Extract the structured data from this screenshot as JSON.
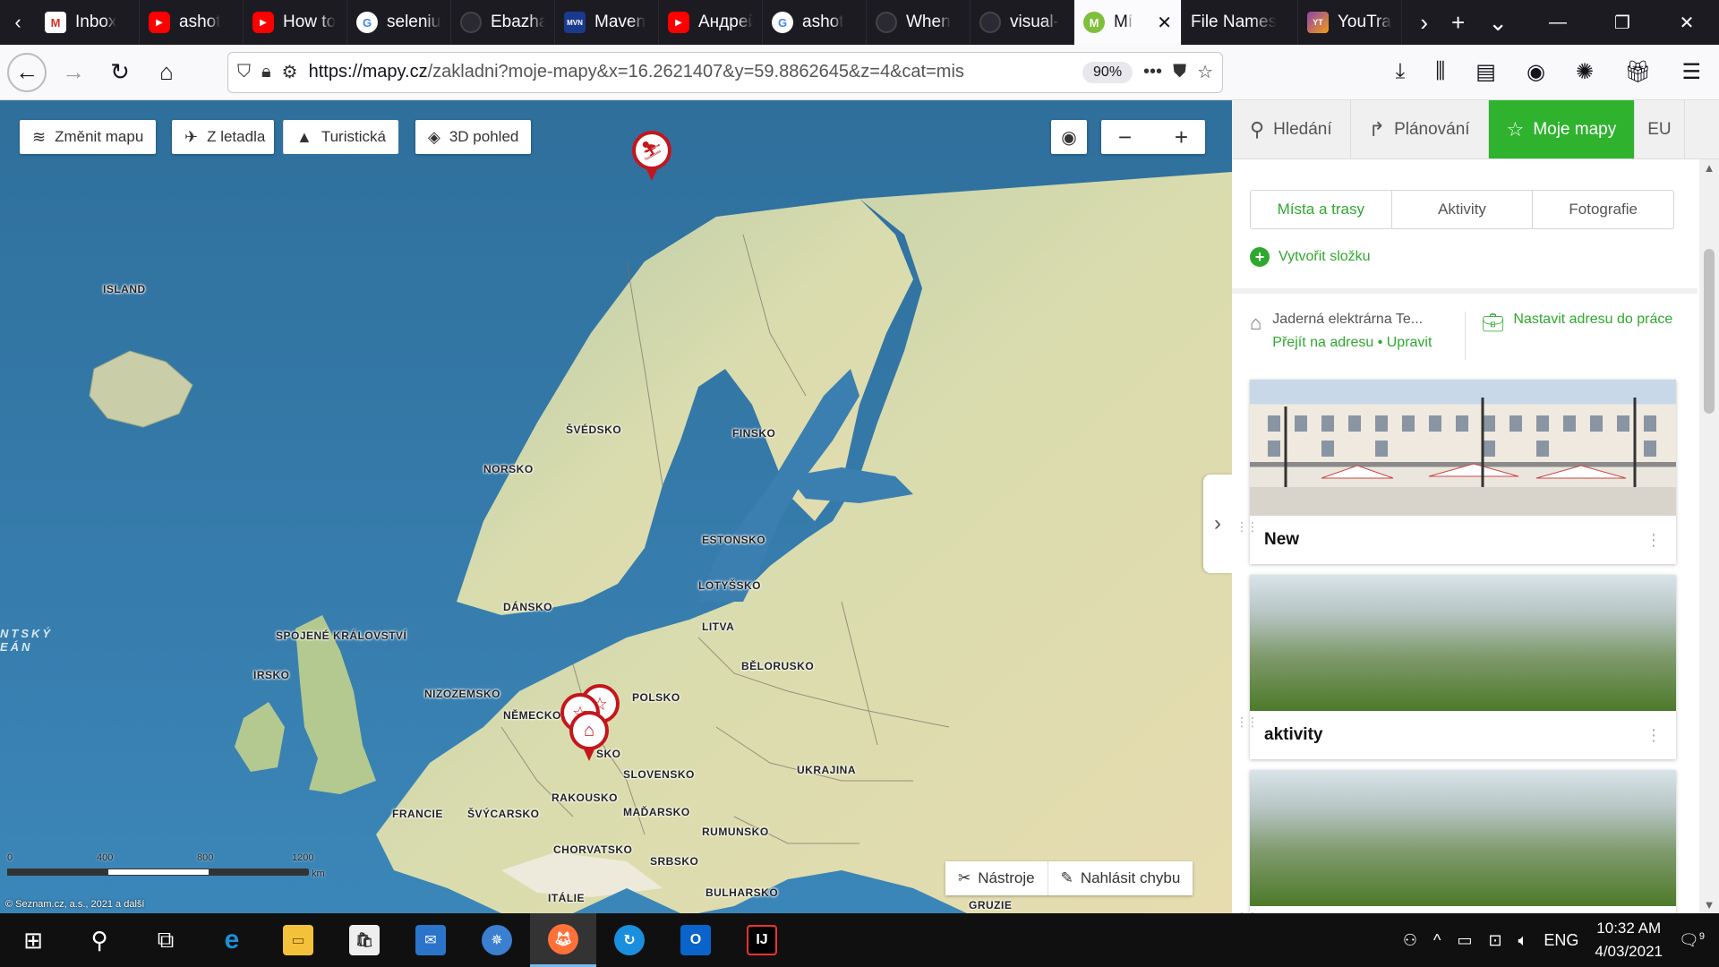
{
  "browser": {
    "tabs": [
      {
        "title": "Inbox",
        "favicon": "gmail-icon",
        "active": false
      },
      {
        "title": "ashot",
        "favicon": "youtube-icon",
        "active": false
      },
      {
        "title": "How to",
        "favicon": "youtube-icon",
        "active": false
      },
      {
        "title": "selenium",
        "favicon": "google-icon",
        "active": false
      },
      {
        "title": "Ebazhanov",
        "favicon": "github-icon",
        "active": false
      },
      {
        "title": "Maven",
        "favicon": "maven-icon",
        "active": false
      },
      {
        "title": "Андрей",
        "favicon": "youtube-icon",
        "active": false
      },
      {
        "title": "ashot",
        "favicon": "google-icon",
        "active": false
      },
      {
        "title": "When",
        "favicon": "github-icon",
        "active": false
      },
      {
        "title": "visual-",
        "favicon": "github-icon",
        "active": false
      },
      {
        "title": "Mí",
        "favicon": "mapy-icon",
        "active": true
      },
      {
        "title": "File Names",
        "favicon": "none",
        "active": false
      },
      {
        "title": "YouTrack",
        "favicon": "youtrack-icon",
        "active": false
      }
    ],
    "url_host": "https://mapy.cz",
    "url_rest": "/zakladni?moje-mapy&x=16.2621407&y=59.8862645&z=4&cat=mis",
    "zoom": "90%"
  },
  "map": {
    "buttons": {
      "change_map": "Změnit mapu",
      "aerial": "Z letadla",
      "tourist": "Turistická",
      "view_3d": "3D pohled"
    },
    "countries": [
      {
        "name": "ISLAND"
      },
      {
        "name": "ŠVÉDSKO"
      },
      {
        "name": "FINSKO"
      },
      {
        "name": "NORSKO"
      },
      {
        "name": "ESTONSKO"
      },
      {
        "name": "LOTYŠSKO"
      },
      {
        "name": "DÁNSKO"
      },
      {
        "name": "LITVA"
      },
      {
        "name": "SPOJENÉ KRÁLOVSTVÍ"
      },
      {
        "name": "BĚLORUSKO"
      },
      {
        "name": "IRSKO"
      },
      {
        "name": "NIZOZEMSKO"
      },
      {
        "name": "POLSKO"
      },
      {
        "name": "NĚMECKO"
      },
      {
        "name": "SKO"
      },
      {
        "name": "SLOVENSKO"
      },
      {
        "name": "UKRAJINA"
      },
      {
        "name": "RAKOUSKO"
      },
      {
        "name": "FRANCIE"
      },
      {
        "name": "ŠVÝCARSKO"
      },
      {
        "name": "MAĎARSKO"
      },
      {
        "name": "RUMUNSKO"
      },
      {
        "name": "CHORVATSKO"
      },
      {
        "name": "SRBSKO"
      },
      {
        "name": "ITÁLIE"
      },
      {
        "name": "BULHARSKO"
      },
      {
        "name": "GRUZIE"
      }
    ],
    "ocean_label": "NTSKÝ\nEÁN",
    "scale": {
      "labels": [
        "0",
        "400",
        "800",
        "1200"
      ],
      "unit": "km"
    },
    "copyright": "© Seznam.cz, a.s., 2021 a další",
    "tools": "Nástroje",
    "report": "Nahlásit chybu"
  },
  "panel": {
    "tabs": {
      "search": "Hledání",
      "planning": "Plánování",
      "my_maps": "Moje mapy",
      "lang": "EU"
    },
    "subtabs": [
      "Místa a trasy",
      "Aktivity",
      "Fotografie"
    ],
    "create_folder": "Vytvořit složku",
    "home": {
      "name": "Jaderná elektrárna Te...",
      "goto": "Přejít na adresu",
      "sep": " • ",
      "edit": "Upravit"
    },
    "work": "Nastavit adresu do práce",
    "cards": [
      {
        "title": "New"
      },
      {
        "title": "aktivity"
      },
      {
        "title": ""
      }
    ]
  },
  "taskbar": {
    "lang": "ENG",
    "time": "10:32 AM",
    "date": "4/03/2021",
    "notifications": "9"
  },
  "colors": {
    "accent_green": "#2fb32f",
    "pin_red": "#c4161c"
  }
}
